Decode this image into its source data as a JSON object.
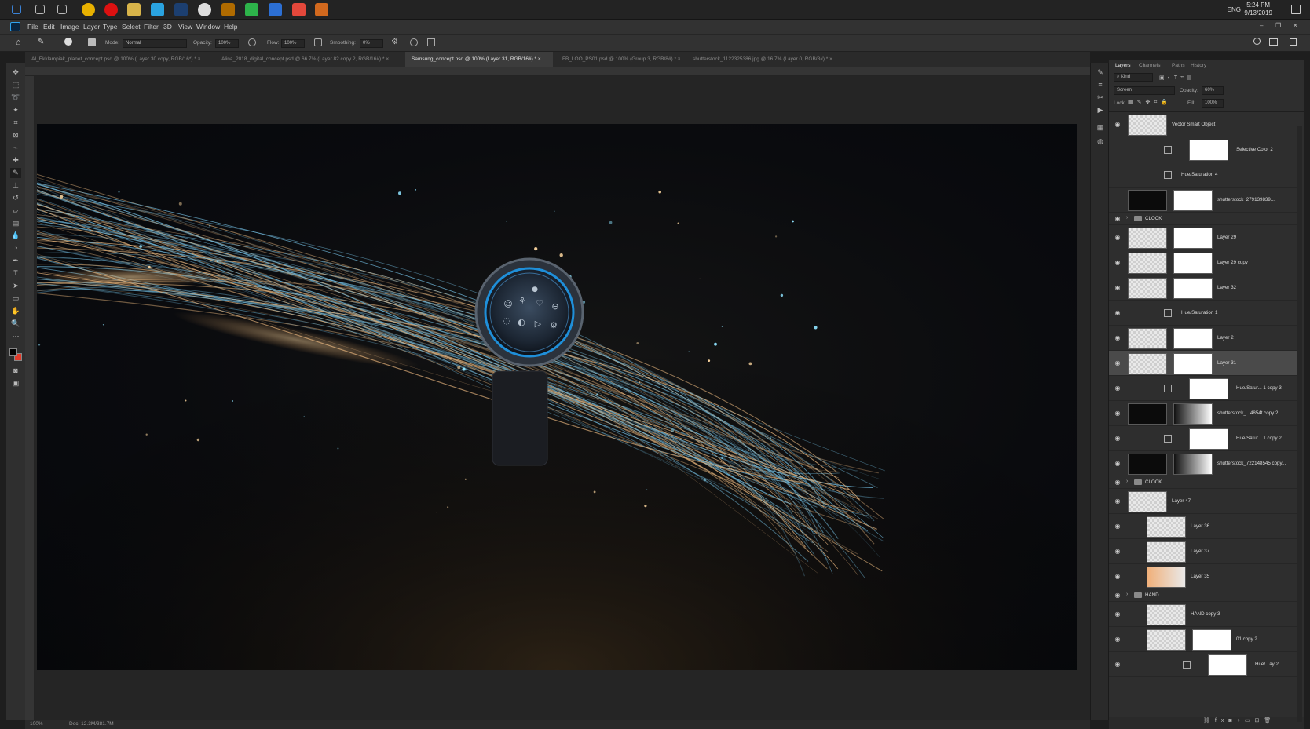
{
  "taskbar": {
    "clock_time": "5:24 PM",
    "clock_date": "9/13/2019",
    "language": "ENG",
    "apps": [
      "windows-icon",
      "search-icon",
      "task-view-icon",
      "chrome-icon",
      "opera-icon",
      "explorer-icon",
      "telegram-icon",
      "photoshop-icon",
      "app-icon",
      "bridge-icon",
      "camtasia-icon",
      "app-icon",
      "app-icon",
      "illustrator-icon"
    ]
  },
  "menubar": {
    "items": [
      "File",
      "Edit",
      "Image",
      "Layer",
      "Type",
      "Select",
      "Filter",
      "3D",
      "View",
      "Window",
      "Help"
    ]
  },
  "options": {
    "mode_label": "Mode:",
    "mode_value": "Normal",
    "opacity_label": "Opacity:",
    "opacity_value": "100%",
    "flow_label": "Flow:",
    "flow_value": "100%",
    "smoothing_label": "Smoothing:",
    "smoothing_value": "0%"
  },
  "tabs": [
    {
      "label": "AI_Ekklampiak_planet_concept.psd @ 100% (Layer 30 copy, RGB/16*) *",
      "active": false
    },
    {
      "label": "Alina_2018_digital_concept.psd @ 66.7% (Layer 82 copy 2, RGB/16#) *",
      "active": false
    },
    {
      "label": "Samsung_concept.psd @ 100% (Layer 31, RGB/16#) *",
      "active": true
    },
    {
      "label": "FB_LOO_PS01.psd @ 100% (Group 3, RGB/8#) *",
      "active": false
    },
    {
      "label": "shutterstock_1122325386.jpg @ 16.7% (Layer 0, RGB/8#) *",
      "active": false
    }
  ],
  "status": {
    "zoom": "100%",
    "doc": "Doc: 12.3M/381.7M"
  },
  "panel": {
    "tabs": [
      "Layers",
      "Channels",
      "Paths",
      "History"
    ],
    "kind_label": "Kind",
    "blend_mode": "Screen",
    "opacity_label": "Opacity:",
    "opacity_value": "60%",
    "lock_label": "Lock:",
    "fill_label": "Fill:",
    "fill_value": "100%",
    "layers": [
      {
        "name": "Vector Smart Object",
        "kind": "smart",
        "eye": true
      },
      {
        "name": "Selective Color 2",
        "kind": "adjust-mask",
        "eye": false
      },
      {
        "name": "Hue/Saturation 4",
        "kind": "adjust",
        "eye": false
      },
      {
        "name": "shutterstock_279139839....",
        "kind": "image-mask",
        "eye": false
      },
      {
        "name": "CLOCK",
        "kind": "group",
        "eye": true
      },
      {
        "name": "Layer 29",
        "kind": "image-mask",
        "eye": true
      },
      {
        "name": "Layer 29 copy",
        "kind": "image-mask",
        "eye": true
      },
      {
        "name": "Layer 32",
        "kind": "image-mask",
        "eye": true
      },
      {
        "name": "Hue/Saturation 1",
        "kind": "adjust",
        "eye": true
      },
      {
        "name": "Layer 2",
        "kind": "image-mask",
        "eye": true
      },
      {
        "name": "Layer 31",
        "kind": "image-mask",
        "eye": true,
        "selected": true
      },
      {
        "name": "Hue/Satur... 1 copy 3",
        "kind": "adjust-mask",
        "eye": true
      },
      {
        "name": "shutterstock_...4854t copy 2...",
        "kind": "image-mask",
        "eye": true
      },
      {
        "name": "Hue/Satur... 1 copy 2",
        "kind": "adjust-mask",
        "eye": true
      },
      {
        "name": "shutterstock_722148545 copy...",
        "kind": "image-mask",
        "eye": true
      },
      {
        "name": "CLOCK",
        "kind": "group",
        "eye": true
      },
      {
        "name": "Layer 47",
        "kind": "image",
        "eye": true
      },
      {
        "name": "Layer 36",
        "kind": "image-clip",
        "eye": true
      },
      {
        "name": "Layer 37",
        "kind": "image-clip",
        "eye": true
      },
      {
        "name": "Layer 35",
        "kind": "image-clip",
        "eye": true
      },
      {
        "name": "HAND",
        "kind": "group",
        "eye": true
      },
      {
        "name": "HAND copy 3",
        "kind": "image-clip",
        "eye": true
      },
      {
        "name": "01 copy 2",
        "kind": "image-mask-clip",
        "eye": true
      },
      {
        "name": "Hue/...ay 2",
        "kind": "adjust-mask-clip",
        "eye": true
      }
    ]
  },
  "colors": {
    "accent_blue": "#1f8fd9",
    "foreground": "#000000",
    "background": "#e03a2a"
  }
}
